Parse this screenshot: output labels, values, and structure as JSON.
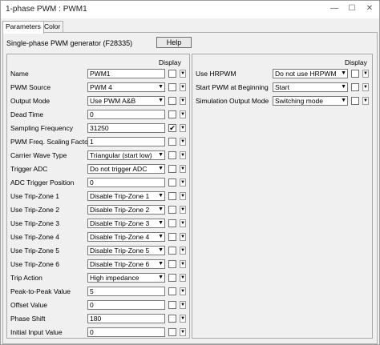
{
  "window": {
    "title": "1-phase PWM : PWM1",
    "minimize_glyph": "—",
    "maximize_glyph": "☐",
    "close_glyph": "✕"
  },
  "tabs": [
    {
      "label": "Parameters",
      "active": true
    },
    {
      "label": "Color",
      "active": false
    }
  ],
  "description": "Single-phase PWM generator (F28335)",
  "help_label": "Help",
  "display_header": "Display",
  "arrow_glyph": "▼",
  "check_glyph": "✔",
  "left_params": [
    {
      "label": "Name",
      "value": "PWM1",
      "kind": "text",
      "checked": false
    },
    {
      "label": "PWM Source",
      "value": "PWM 4",
      "kind": "select",
      "checked": false
    },
    {
      "label": "Output Mode",
      "value": "Use PWM A&B",
      "kind": "select",
      "checked": false
    },
    {
      "label": "Dead Time",
      "value": "0",
      "kind": "text",
      "checked": false
    },
    {
      "label": "Sampling Frequency",
      "value": "31250",
      "kind": "text",
      "checked": true
    },
    {
      "label": "PWM Freq. Scaling Factor",
      "value": "1",
      "kind": "text",
      "checked": false
    },
    {
      "label": "Carrier Wave Type",
      "value": "Triangular (start low)",
      "kind": "select",
      "checked": false
    },
    {
      "label": "Trigger ADC",
      "value": "Do not trigger ADC",
      "kind": "select",
      "checked": false
    },
    {
      "label": "ADC Trigger Position",
      "value": "0",
      "kind": "text",
      "checked": false
    },
    {
      "label": "Use Trip-Zone 1",
      "value": "Disable Trip-Zone 1",
      "kind": "select",
      "checked": false
    },
    {
      "label": "Use Trip-Zone 2",
      "value": "Disable Trip-Zone 2",
      "kind": "select",
      "checked": false
    },
    {
      "label": "Use Trip-Zone 3",
      "value": "Disable Trip-Zone 3",
      "kind": "select",
      "checked": false
    },
    {
      "label": "Use Trip-Zone 4",
      "value": "Disable Trip-Zone 4",
      "kind": "select",
      "checked": false
    },
    {
      "label": "Use Trip-Zone 5",
      "value": "Disable Trip-Zone 5",
      "kind": "select",
      "checked": false
    },
    {
      "label": "Use Trip-Zone 6",
      "value": "Disable Trip-Zone 6",
      "kind": "select",
      "checked": false
    },
    {
      "label": "Trip Action",
      "value": "High impedance",
      "kind": "select",
      "checked": false
    },
    {
      "label": "Peak-to-Peak Value",
      "value": "5",
      "kind": "text",
      "checked": false
    },
    {
      "label": "Offset Value",
      "value": "0",
      "kind": "text",
      "checked": false
    },
    {
      "label": "Phase Shift",
      "value": "180",
      "kind": "text",
      "checked": false
    },
    {
      "label": "Initial Input Value",
      "value": "0",
      "kind": "text",
      "checked": false
    }
  ],
  "right_params": [
    {
      "label": "Use HRPWM",
      "value": "Do not use HRPWM",
      "kind": "select",
      "checked": false
    },
    {
      "label": "Start PWM at Beginning",
      "value": "Start",
      "kind": "select",
      "checked": false
    },
    {
      "label": "Simulation Output Mode",
      "value": "Switching mode",
      "kind": "select",
      "checked": false
    }
  ]
}
